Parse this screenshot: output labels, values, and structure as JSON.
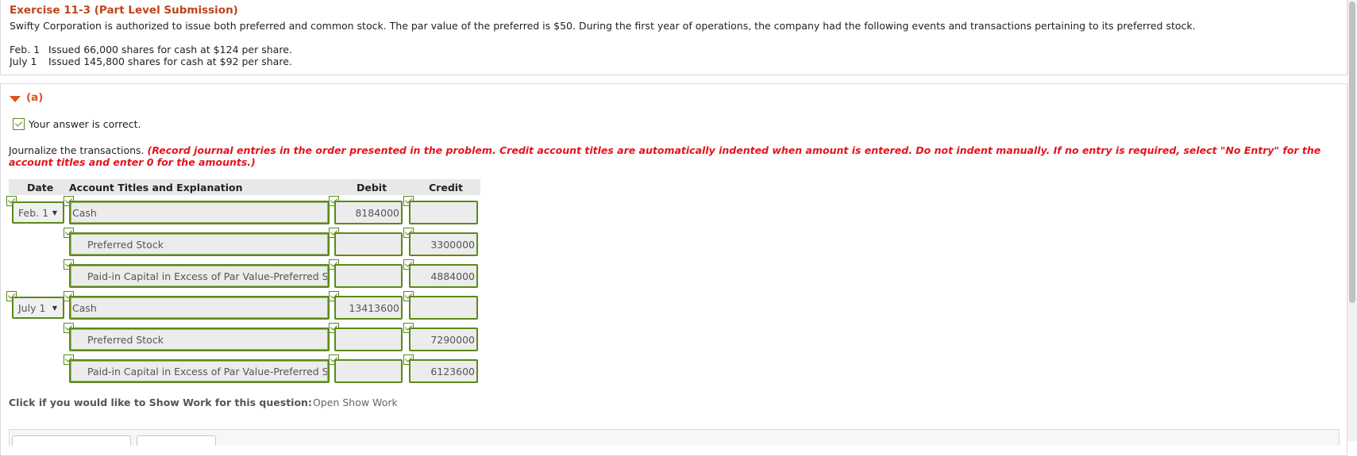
{
  "exercise": {
    "title": "Exercise 11-3 (Part Level Submission)",
    "text": "Swifty Corporation is authorized to issue both preferred and common stock. The par value of the preferred is $50. During the first year of operations, the company had the following events and transactions pertaining to its preferred stock.",
    "events": [
      {
        "date": "Feb. 1",
        "desc": "Issued 66,000 shares for cash at $124 per share."
      },
      {
        "date": "July 1",
        "desc": "Issued 145,800 shares for cash at $92 per share."
      }
    ]
  },
  "part": {
    "label": "(a)",
    "status": "Your answer is correct.",
    "instruction": "Journalize the transactions.",
    "instruction_red": "(Record journal entries in the order presented in the problem. Credit account titles are automatically indented when amount is entered. Do not indent manually. If no entry is required, select \"No Entry\" for the account titles and enter 0 for the amounts.)"
  },
  "table": {
    "headers": {
      "date": "Date",
      "account": "Account Titles and Explanation",
      "debit": "Debit",
      "credit": "Credit"
    },
    "rows": [
      {
        "date": "Feb. 1",
        "account": "Cash",
        "debit": "8184000",
        "credit": ""
      },
      {
        "date": "",
        "account": "Preferred Stock",
        "debit": "",
        "credit": "3300000"
      },
      {
        "date": "",
        "account": "Paid-in Capital in Excess of Par Value-Preferred St",
        "debit": "",
        "credit": "4884000"
      },
      {
        "date": "July 1",
        "account": "Cash",
        "debit": "13413600",
        "credit": ""
      },
      {
        "date": "",
        "account": "Preferred Stock",
        "debit": "",
        "credit": "7290000"
      },
      {
        "date": "",
        "account": "Paid-in Capital in Excess of Par Value-Preferred St",
        "debit": "",
        "credit": "6123600"
      }
    ]
  },
  "show_work": {
    "prompt": "Click if you would like to Show Work for this question:",
    "link": "Open Show Work"
  },
  "icons": {
    "dropdown_arrow": "▼"
  },
  "colors": {
    "accent": "#d9541e",
    "correct_green": "#5a8a1a",
    "instruction_red": "#e3141c"
  }
}
